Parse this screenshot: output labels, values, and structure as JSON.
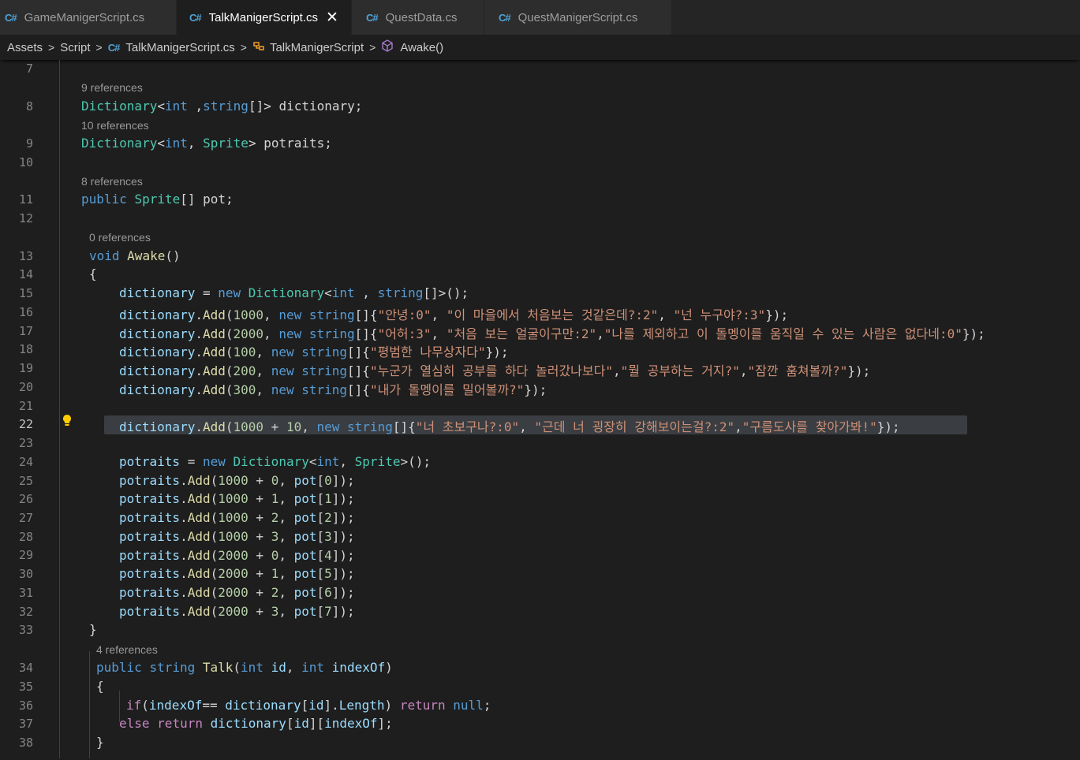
{
  "tabs": [
    {
      "label": "GameManigerScript.cs",
      "active": false
    },
    {
      "label": "TalkManigerScript.cs",
      "active": true
    },
    {
      "label": "QuestData.cs",
      "active": false
    },
    {
      "label": "QuestManigerScript.cs",
      "active": false
    }
  ],
  "tab_icon": "C#",
  "close_glyph": "✕",
  "breadcrumb": {
    "items": [
      "Assets",
      "Script",
      "TalkManigerScript.cs",
      "TalkManigerScript",
      "Awake()"
    ]
  },
  "lenses": {
    "l8": "9 references",
    "l9": "10 references",
    "l11": "8 references",
    "l13": "0 references",
    "l34": "4 references"
  },
  "line_numbers": [
    "7",
    "8",
    "9",
    "10",
    "11",
    "12",
    "13",
    "14",
    "15",
    "16",
    "17",
    "18",
    "19",
    "20",
    "21",
    "22",
    "23",
    "24",
    "25",
    "26",
    "27",
    "28",
    "29",
    "30",
    "31",
    "32",
    "33",
    "34",
    "35",
    "36",
    "37",
    "38"
  ],
  "current_line": "22",
  "code": {
    "l8": [
      "Dictionary",
      "<",
      "int",
      " ,",
      "string",
      "[]> dictionary;"
    ],
    "l9": [
      "Dictionary",
      "<",
      "int",
      ", ",
      "Sprite",
      "> potraits;"
    ],
    "l11": [
      "public",
      " ",
      "Sprite",
      "[] pot;"
    ],
    "l13": [
      "void",
      " ",
      "Awake",
      "()"
    ],
    "l14": [
      "{"
    ],
    "l15": [
      "dictionary",
      " = ",
      "new",
      " ",
      "Dictionary",
      "<",
      "int",
      " , ",
      "string",
      "[]>();"
    ],
    "l16": [
      "dictionary",
      ".",
      "Add",
      "(",
      "1000",
      ", ",
      "new",
      " ",
      "string",
      "[]{",
      "\"안녕:0\"",
      ", ",
      "\"이 마을에서 처음보는 것같은데?:2\"",
      ", ",
      "\"넌 누구야?:3\"",
      "});"
    ],
    "l17": [
      "dictionary",
      ".",
      "Add",
      "(",
      "2000",
      ", ",
      "new",
      " ",
      "string",
      "[]{",
      "\"어허:3\"",
      ", ",
      "\"처음 보는 얼굴이구만:2\"",
      ",",
      "\"나를 제외하고 이 돌멩이를 움직일 수 있는 사람은 없다네:0\"",
      "});"
    ],
    "l18": [
      "dictionary",
      ".",
      "Add",
      "(",
      "100",
      ", ",
      "new",
      " ",
      "string",
      "[]{",
      "\"평범한 나무상자다\"",
      "});"
    ],
    "l19": [
      "dictionary",
      ".",
      "Add",
      "(",
      "200",
      ", ",
      "new",
      " ",
      "string",
      "[]{",
      "\"누군가 열심히 공부를 하다 놀러갔나보다\"",
      ",",
      "\"뭘 공부하는 거지?\"",
      ",",
      "\"잠깐 훔쳐볼까?\"",
      "});"
    ],
    "l20": [
      "dictionary",
      ".",
      "Add",
      "(",
      "300",
      ", ",
      "new",
      " ",
      "string",
      "[]{",
      "\"내가 돌멩이를 밀어볼까?\"",
      "});"
    ],
    "l22": [
      "dictionary",
      ".",
      "Add",
      "(",
      "1000",
      " + ",
      "10",
      ", ",
      "new",
      " ",
      "string",
      "[]{",
      "\"너 초보구나?:0\"",
      ", ",
      "\"근데 너 굉장히 강해보이는걸?:2\"",
      ",",
      "\"구름도사를 찾아가봐!\"",
      "});"
    ],
    "l24": [
      "potraits",
      " = ",
      "new",
      " ",
      "Dictionary",
      "<",
      "int",
      ", ",
      "Sprite",
      ">();"
    ],
    "potraits_adds": [
      {
        "base": "1000",
        "off": "0",
        "idx": "0"
      },
      {
        "base": "1000",
        "off": "1",
        "idx": "1"
      },
      {
        "base": "1000",
        "off": "2",
        "idx": "2"
      },
      {
        "base": "1000",
        "off": "3",
        "idx": "3"
      },
      {
        "base": "2000",
        "off": "0",
        "idx": "4"
      },
      {
        "base": "2000",
        "off": "1",
        "idx": "5"
      },
      {
        "base": "2000",
        "off": "2",
        "idx": "6"
      },
      {
        "base": "2000",
        "off": "3",
        "idx": "7"
      }
    ],
    "l33": [
      "}"
    ],
    "l34": [
      "public",
      " ",
      "string",
      " ",
      "Talk",
      "(",
      "int",
      " ",
      "id",
      ", ",
      "int",
      " ",
      "indexOf",
      ")"
    ],
    "l35": [
      "{"
    ],
    "l36": [
      "if",
      "(",
      "indexOf",
      "== ",
      "dictionary",
      "[",
      "id",
      "].",
      "Length",
      ") ",
      "return",
      " ",
      "null",
      ";"
    ],
    "l37": [
      "else",
      " ",
      "return",
      " ",
      "dictionary",
      "[",
      "id",
      "][",
      "indexOf",
      "];"
    ],
    "l38": [
      "}"
    ]
  },
  "colors": {
    "background": "#1e1e1e",
    "keyword": "#569cd6",
    "control_keyword": "#c586c0",
    "type": "#4ec9b0",
    "variable": "#9cdcfe",
    "function": "#dcdcaa",
    "number": "#b5cea8",
    "string": "#ce9178"
  },
  "icons": {
    "lightbulb": "lightbulb-icon",
    "csharp": "csharp-file-icon",
    "class": "class-icon",
    "method": "method-cube-icon"
  }
}
